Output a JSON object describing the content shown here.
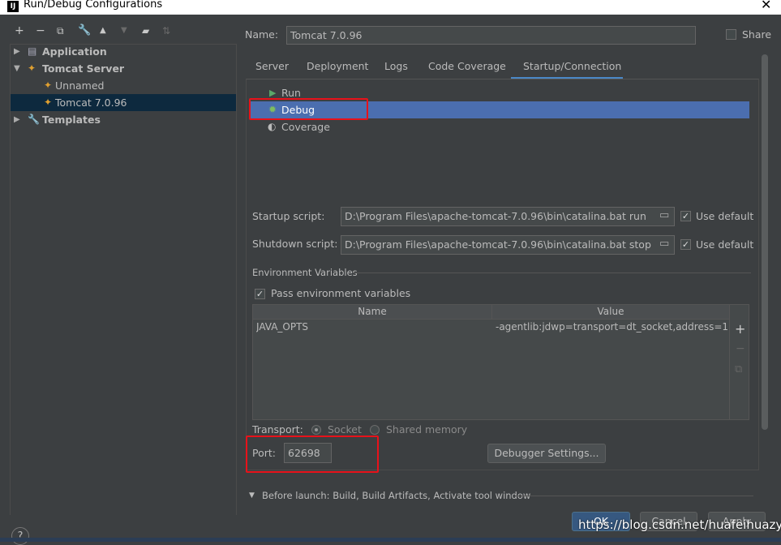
{
  "window": {
    "title": "Run/Debug Configurations",
    "logo": "IJ"
  },
  "toolbar": {
    "icons": [
      "add-icon",
      "remove-icon",
      "copy-icon",
      "wrench-icon",
      "move-up-icon",
      "move-down-icon",
      "new-folder-icon",
      "sort-icon"
    ]
  },
  "tree": {
    "items": [
      {
        "label": "Application"
      },
      {
        "label": "Tomcat Server"
      },
      {
        "label": "Unnamed"
      },
      {
        "label": "Tomcat 7.0.96"
      },
      {
        "label": "Templates"
      }
    ]
  },
  "name_row": {
    "label": "Name:",
    "value": "Tomcat 7.0.96",
    "share_label": "Share"
  },
  "tabs": [
    "Server",
    "Deployment",
    "Logs",
    "Code Coverage",
    "Startup/Connection"
  ],
  "modes": [
    "Run",
    "Debug",
    "Coverage"
  ],
  "startup": {
    "label": "Startup script:",
    "value": "D:\\Program Files\\apache-tomcat-7.0.96\\bin\\catalina.bat run",
    "default_label": "Use default"
  },
  "shutdown": {
    "label": "Shutdown script:",
    "value": "D:\\Program Files\\apache-tomcat-7.0.96\\bin\\catalina.bat stop",
    "default_label": "Use default"
  },
  "env": {
    "section_label": "Environment Variables",
    "pass_label": "Pass environment variables",
    "columns": [
      "Name",
      "Value"
    ],
    "rows": [
      {
        "name": "JAVA_OPTS",
        "value": "-agentlib:jdwp=transport=dt_socket,address=1..."
      }
    ],
    "side_buttons": [
      "+",
      "−",
      "⧉"
    ]
  },
  "transport": {
    "label": "Transport:",
    "socket_label": "Socket",
    "shared_label": "Shared memory"
  },
  "port": {
    "label": "Port:",
    "value": "62698"
  },
  "debugger_settings_label": "Debugger Settings...",
  "before_launch": "Before launch: Build, Build Artifacts, Activate tool window",
  "buttons": {
    "ok": "OK",
    "cancel": "Cancel",
    "apply": "Apply",
    "help": "?"
  },
  "watermark": "https://blog.csdn.net/huafeihuazyr",
  "colors": {
    "selection": "#4b6eaf",
    "tree_selection": "#0d293e",
    "highlight_box": "#e8121a",
    "tab_underline": "#4a88c7"
  }
}
